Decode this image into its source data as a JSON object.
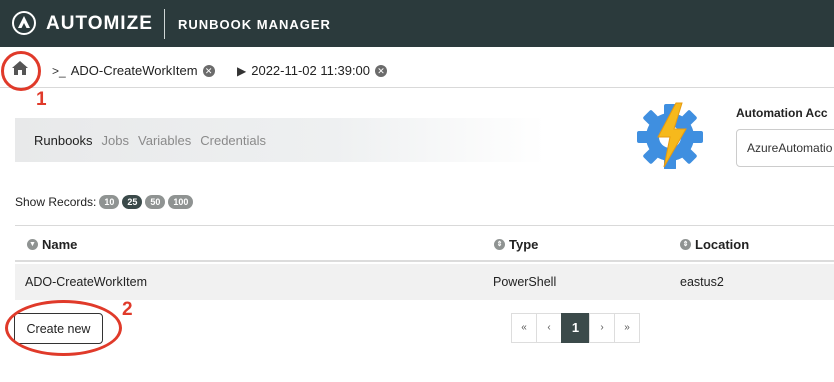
{
  "header": {
    "brand": "AUTOMIZE",
    "app_title": "RUNBOOK MANAGER"
  },
  "tabs": [
    {
      "label": "ADO-CreateWorkItem",
      "icon": "terminal-icon"
    },
    {
      "label": "2022-11-02 11:39:00",
      "icon": "play-icon"
    }
  ],
  "subnav": [
    "Runbooks",
    "Jobs",
    "Variables",
    "Credentials"
  ],
  "automation_account": {
    "label": "Automation Acc",
    "value": "AzureAutomatio"
  },
  "records": {
    "label": "Show Records:",
    "options": [
      "10",
      "25",
      "50",
      "100"
    ],
    "selected": "25"
  },
  "table": {
    "columns": [
      "Name",
      "Type",
      "Location"
    ],
    "rows": [
      [
        "ADO-CreateWorkItem",
        "PowerShell",
        "eastus2"
      ]
    ]
  },
  "create_button": "Create new",
  "pagination": {
    "first": "«",
    "prev": "‹",
    "current": "1",
    "next": "›",
    "last": "»"
  },
  "annotations": [
    "1",
    "2"
  ],
  "colors": {
    "topbar": "#2b3a3c",
    "annotation": "#e03a2a",
    "active_pill": "#3b4a4a"
  }
}
